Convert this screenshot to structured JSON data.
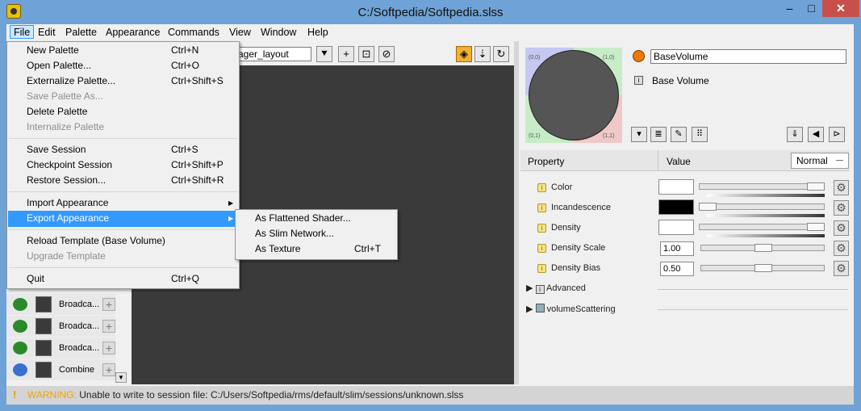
{
  "window": {
    "title": "C:/Softpedia/Softpedia.slss",
    "minimize": "–",
    "maximize": "□",
    "close": "✕"
  },
  "menubar": {
    "items": [
      "File",
      "Edit",
      "Palette",
      "Appearance",
      "Commands",
      "View",
      "Window",
      "Help"
    ]
  },
  "file_menu": {
    "items": [
      {
        "label": "New Palette",
        "shortcut": "Ctrl+N",
        "enabled": true
      },
      {
        "label": "Open Palette...",
        "shortcut": "Ctrl+O",
        "enabled": true
      },
      {
        "label": "Externalize Palette...",
        "shortcut": "Ctrl+Shift+S",
        "enabled": true
      },
      {
        "label": "Save Palette As...",
        "shortcut": "",
        "enabled": false
      },
      {
        "label": "Delete Palette",
        "shortcut": "",
        "enabled": true
      },
      {
        "label": "Internalize Palette",
        "shortcut": "",
        "enabled": false
      },
      {
        "label": "Save Session",
        "shortcut": "Ctrl+S",
        "enabled": true
      },
      {
        "label": "Checkpoint Session",
        "shortcut": "Ctrl+Shift+P",
        "enabled": true
      },
      {
        "label": "Restore Session...",
        "shortcut": "Ctrl+Shift+R",
        "enabled": true
      },
      {
        "label": "Import Appearance",
        "shortcut": "",
        "enabled": true
      },
      {
        "label": "Export Appearance",
        "shortcut": "",
        "enabled": true
      },
      {
        "label": "Reload Template (Base Volume)",
        "shortcut": "",
        "enabled": true
      },
      {
        "label": "Upgrade Template",
        "shortcut": "",
        "enabled": false
      },
      {
        "label": "Quit",
        "shortcut": "Ctrl+Q",
        "enabled": true
      }
    ]
  },
  "export_submenu": {
    "items": [
      {
        "label": "As Flattened Shader...",
        "shortcut": ""
      },
      {
        "label": "As Slim Network...",
        "shortcut": ""
      },
      {
        "label": "As Texture",
        "shortcut": "Ctrl+T"
      }
    ]
  },
  "toolbar": {
    "layout": "ager_layout"
  },
  "nodes": [
    {
      "label": "Broadca..."
    },
    {
      "label": "Broadca..."
    },
    {
      "label": "Broadca..."
    },
    {
      "label": "Combine"
    }
  ],
  "inspector": {
    "name": "BaseVolume",
    "type_label": "Base Volume",
    "swatch_labels": [
      "(0,0)",
      "(1,0)",
      "(1,1)",
      "(0,1)"
    ],
    "header": {
      "property": "Property",
      "value": "Value",
      "mode": "Normal"
    },
    "properties": [
      {
        "label": "Color",
        "kind": "color",
        "color": "#ffffff",
        "slider": 0.94
      },
      {
        "label": "Incandescence",
        "kind": "color",
        "color": "#000000",
        "slider": 0.05
      },
      {
        "label": "Density",
        "kind": "color",
        "color": "#ffffff",
        "slider": 0.94
      },
      {
        "label": "Density Scale",
        "kind": "number",
        "value": "1.00",
        "slider": 0.5
      },
      {
        "label": "Density Bias",
        "kind": "number",
        "value": "0.50",
        "slider": 0.5
      }
    ],
    "groups": [
      {
        "label": "Advanced"
      },
      {
        "label": "volumeScattering"
      }
    ]
  },
  "status": {
    "level": "WARNING:",
    "message": "Unable to write to session file: C:/Users/Softpedia/rms/default/slim/sessions/unknown.slss"
  },
  "colors": {
    "title_bar": "#6fa2d6",
    "highlight": "#3399ff",
    "canvas": "#3a3a3a",
    "close": "#c7504b"
  }
}
